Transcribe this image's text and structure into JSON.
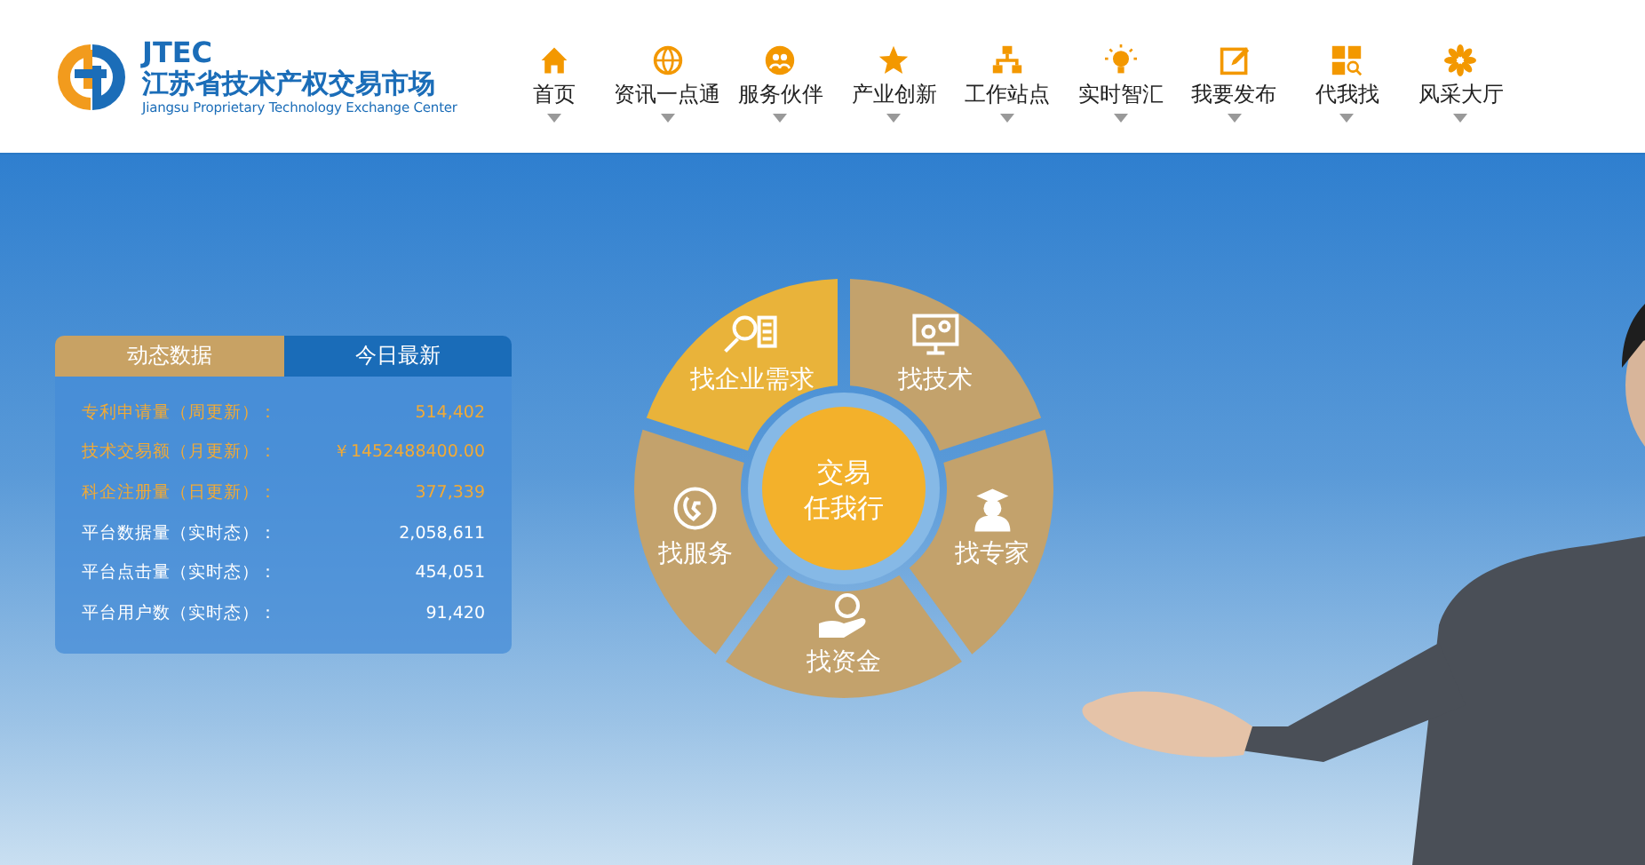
{
  "logo": {
    "abbr": "JTEC",
    "name": "江苏省技术产权交易市场",
    "english": "Jiangsu Proprietary Technology Exchange Center"
  },
  "nav": [
    {
      "label": "首页"
    },
    {
      "label": "资讯一点通"
    },
    {
      "label": "服务伙伴"
    },
    {
      "label": "产业创新"
    },
    {
      "label": "工作站点"
    },
    {
      "label": "实时智汇"
    },
    {
      "label": "我要发布"
    },
    {
      "label": "代我找"
    },
    {
      "label": "风采大厅"
    }
  ],
  "stats": {
    "tabs": [
      {
        "label": "动态数据",
        "selected": true
      },
      {
        "label": "今日最新",
        "selected": false
      }
    ],
    "rows": [
      {
        "label": "专利申请量（周更新）：",
        "value": "514,402",
        "color": "#f2aa35"
      },
      {
        "label": "技术交易额（月更新）：",
        "value": "￥1452488400.00",
        "color": "#f2aa35"
      },
      {
        "label": "科企注册量（日更新）：",
        "value": "377,339",
        "color": "#f2aa35"
      },
      {
        "label": "平台数据量（实时态）：",
        "value": "2,058,611",
        "color": "#ffffff"
      },
      {
        "label": "平台点击量（实时态）：",
        "value": "454,051",
        "color": "#ffffff"
      },
      {
        "label": "平台用户数（实时态）：",
        "value": "91,420",
        "color": "#ffffff"
      }
    ]
  },
  "wheel": {
    "center_lines": [
      "交易",
      "任我行"
    ],
    "segments": [
      {
        "label": "找企业需求",
        "selected": true
      },
      {
        "label": "找技术",
        "selected": false
      },
      {
        "label": "找专家",
        "selected": false
      },
      {
        "label": "找资金",
        "selected": false
      },
      {
        "label": "找服务",
        "selected": false
      }
    ]
  }
}
